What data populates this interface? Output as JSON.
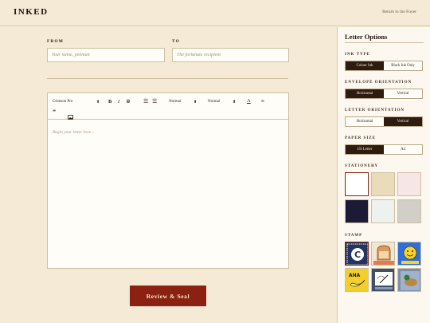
{
  "header": {
    "logo": "INKED",
    "return_link": "Return to the Foyer"
  },
  "form": {
    "from_label": "FROM",
    "from_placeholder": "Your name, penman",
    "to_label": "TO",
    "to_placeholder": "The fortunate recipient"
  },
  "editor": {
    "font_select": "Crimson Pro",
    "heading_select": "Normal",
    "size_select": "Normal",
    "body_placeholder": "Begin your letter here..."
  },
  "submit_label": "Review & Seal",
  "sidebar": {
    "title": "Letter Options",
    "ink_type": {
      "label": "INK TYPE",
      "options": [
        "Colour Ink",
        "Black Ink Only"
      ],
      "selected": "Colour Ink"
    },
    "envelope_orientation": {
      "label": "ENVELOPE ORIENTATION",
      "options": [
        "Horizontal",
        "Vertical"
      ],
      "selected": "Horizontal"
    },
    "letter_orientation": {
      "label": "LETTER ORIENTATION",
      "options": [
        "Horizontal",
        "Vertical"
      ],
      "selected": "Vertical"
    },
    "paper_size": {
      "label": "PAPER SIZE",
      "options": [
        "US Letter",
        "A4"
      ],
      "selected": "US Letter"
    },
    "stationery": {
      "label": "STATIONERY",
      "swatches": [
        "#ffffff",
        "#eadcba",
        "#f7e6e6",
        "#1b1b35",
        "#eef2ee",
        "#d2cfc8"
      ],
      "selected_index": 0
    },
    "stamp": {
      "label": "STAMP",
      "stamps": [
        {
          "name": "c-logo-stamp",
          "text": "C"
        },
        {
          "name": "toast-post-stamp",
          "text": "TOAST POST"
        },
        {
          "name": "awesome-stamp",
          "text": "AWESOME"
        },
        {
          "name": "ana-banana-stamp",
          "text": "ANA"
        },
        {
          "name": "pen-ink-stamp",
          "text": ""
        },
        {
          "name": "mallard-stamp",
          "text": ""
        }
      ],
      "selected_index": 0
    }
  }
}
